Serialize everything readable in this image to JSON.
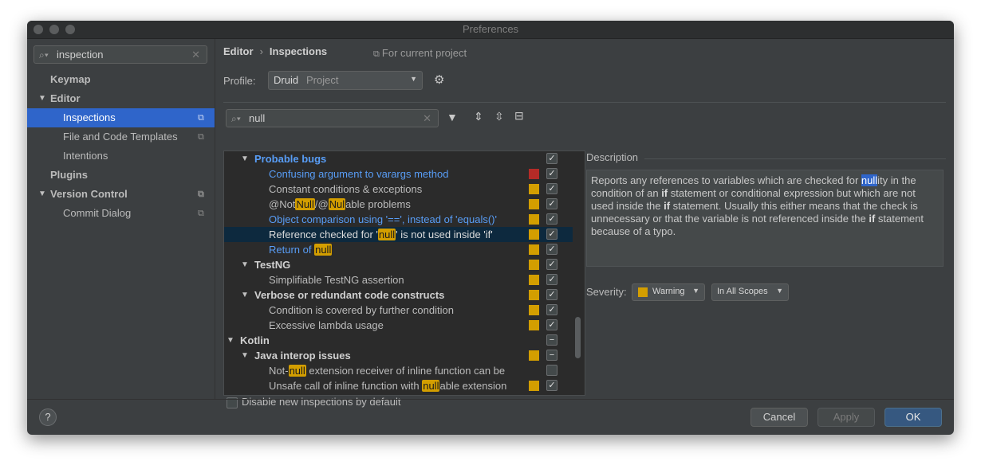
{
  "window": {
    "title": "Preferences"
  },
  "sidebar": {
    "search_value": "inspection",
    "items": [
      {
        "label": "Keymap"
      },
      {
        "label": "Editor"
      },
      {
        "label": "Inspections"
      },
      {
        "label": "File and Code Templates"
      },
      {
        "label": "Intentions"
      },
      {
        "label": "Plugins"
      },
      {
        "label": "Version Control"
      },
      {
        "label": "Commit Dialog"
      }
    ]
  },
  "header": {
    "crumb_1": "Editor",
    "crumb_sep": "›",
    "crumb_2": "Inspections",
    "scope_note": "For current project"
  },
  "profile": {
    "label": "Profile:",
    "name": "Druid",
    "type": "Project"
  },
  "filter": {
    "value": "null"
  },
  "tree": {
    "rows": [
      {
        "parts": [
          "Probable bugs"
        ]
      },
      {
        "parts": [
          "Confusing argument to varargs method"
        ]
      },
      {
        "parts": [
          "Constant conditions & exceptions"
        ]
      },
      {
        "parts": [
          "@Not",
          "Null",
          "/@",
          "Nul",
          "able problems"
        ]
      },
      {
        "parts": [
          "Object comparison using '==', instead of 'equals()'"
        ]
      },
      {
        "parts": [
          "Reference checked for '",
          "null",
          "' is not used inside 'if'"
        ]
      },
      {
        "parts": [
          "Return of ",
          "null"
        ]
      },
      {
        "parts": [
          "TestNG"
        ]
      },
      {
        "parts": [
          "Simplifiable TestNG assertion"
        ]
      },
      {
        "parts": [
          "Verbose or redundant code constructs"
        ]
      },
      {
        "parts": [
          "Condition is covered by further condition"
        ]
      },
      {
        "parts": [
          "Excessive lambda usage"
        ]
      },
      {
        "parts": [
          "Kotlin"
        ]
      },
      {
        "parts": [
          "Java interop issues"
        ]
      },
      {
        "parts": [
          "Not-",
          "null",
          " extension receiver of inline function can be"
        ]
      },
      {
        "parts": [
          "Unsafe call of inline function with ",
          "null",
          "able extension"
        ]
      }
    ]
  },
  "disable_new": {
    "label": "Disable new inspections by default"
  },
  "description": {
    "title": "Description",
    "t1": "Reports any references to variables which are checked for ",
    "t1_hl": "null",
    "t2": "ity in the condition of an ",
    "b1": "if",
    "t3": " statement or conditional expression but which are not used inside the ",
    "b2": "if",
    "t4": " statement. Usually this either means that the check is unnecessary or that the variable is not referenced inside the ",
    "b3": "if",
    "t5": " statement because of a typo."
  },
  "severity": {
    "label": "Severity:",
    "value": "Warning",
    "scope": "In All Scopes"
  },
  "buttons": {
    "help": "?",
    "cancel": "Cancel",
    "apply": "Apply",
    "ok": "OK"
  },
  "colors": {
    "accent": "#2f65ca",
    "link": "#589df6",
    "warning": "#d39e00",
    "error": "#b52b27"
  }
}
